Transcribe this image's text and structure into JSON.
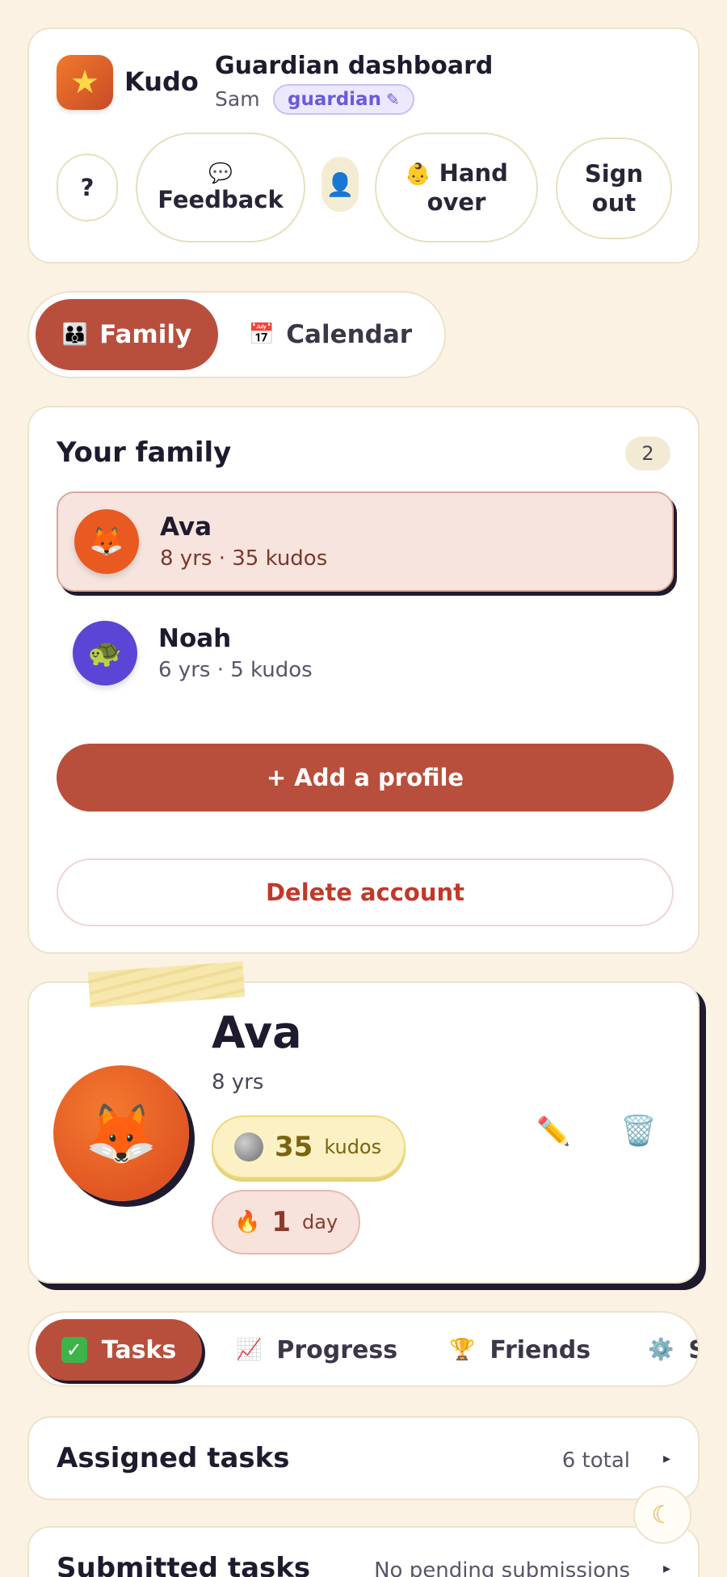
{
  "header": {
    "app_name": "Kudo",
    "logo_icon": "★",
    "title": "Guardian dashboard",
    "user_name": "Sam",
    "role_badge": "guardian",
    "role_edit_icon": "✎",
    "help_label": "?",
    "feedback_icon": "💬",
    "feedback_label": "Feedback",
    "avatar_icon": "👤",
    "handover_icon": "👶",
    "handover_label": "Hand over",
    "signout_label": "Sign out"
  },
  "main_tabs": [
    {
      "icon": "👪",
      "label": "Family",
      "active": true
    },
    {
      "icon": "📅",
      "label": "Calendar",
      "active": false
    }
  ],
  "family": {
    "title": "Your family",
    "count": "2",
    "members": [
      {
        "name": "Ava",
        "meta": "8 yrs · 35 kudos",
        "icon": "🦊",
        "color": "#e85a1f"
      },
      {
        "name": "Noah",
        "meta": "6 yrs · 5 kudos",
        "icon": "🐢",
        "color": "#5a45d6"
      }
    ],
    "add_label": "+ Add a profile",
    "delete_label": "Delete account"
  },
  "profile": {
    "avatar_icon": "🦊",
    "name": "Ava",
    "age": "8 yrs",
    "kudos_value": "35",
    "kudos_unit": "kudos",
    "streak_icon": "🔥",
    "streak_value": "1",
    "streak_unit": "day",
    "edit_icon": "✏️",
    "delete_icon": "🗑️"
  },
  "sub_tabs": [
    {
      "icon": "✓",
      "label": "Tasks",
      "active": true
    },
    {
      "icon": "📈",
      "label": "Progress",
      "active": false
    },
    {
      "icon": "🏆",
      "label": "Friends",
      "active": false
    },
    {
      "icon": "⚙️",
      "label": "S",
      "active": false
    }
  ],
  "sections": [
    {
      "title": "Assigned tasks",
      "meta": "6 total",
      "chevron": "▸"
    },
    {
      "title": "Submitted tasks",
      "meta": "No pending submissions",
      "chevron": "▸"
    }
  ],
  "theme_toggle_icon": "☾",
  "colors": {
    "accent": "#b84f3c",
    "background": "#fbf2e4",
    "danger": "#c0392b"
  }
}
